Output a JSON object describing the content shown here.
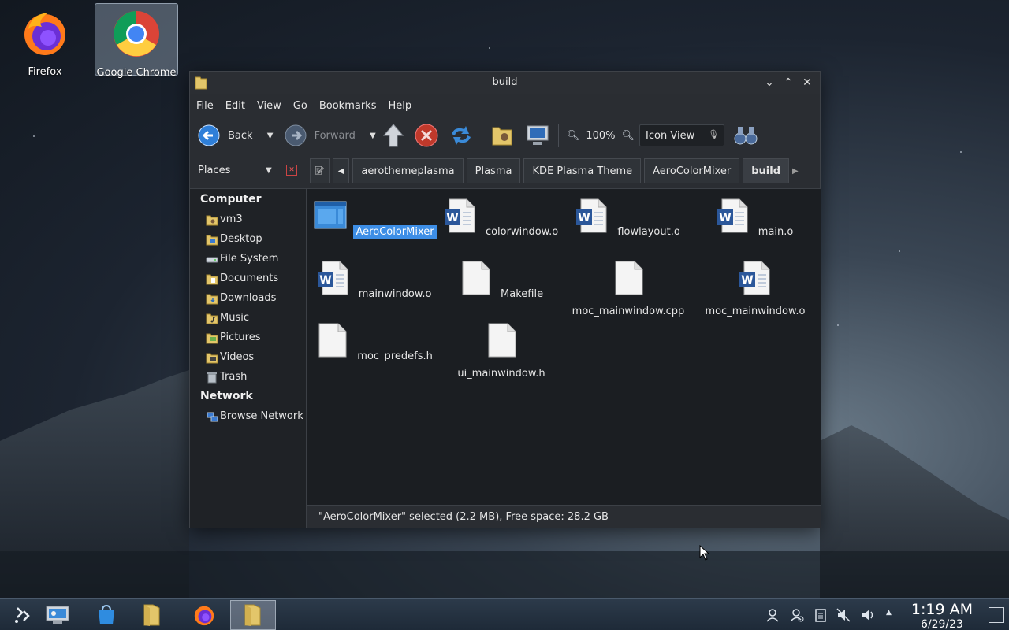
{
  "desktop": {
    "icons": [
      {
        "label": "Firefox"
      },
      {
        "label": "Google Chrome"
      }
    ]
  },
  "window": {
    "title": "build",
    "menu": [
      "File",
      "Edit",
      "View",
      "Go",
      "Bookmarks",
      "Help"
    ],
    "toolbar": {
      "back_label": "Back",
      "forward_label": "Forward",
      "zoom_level": "100%",
      "view_mode": "Icon View"
    },
    "places_label": "Places",
    "breadcrumbs": [
      "aerothemeplasma",
      "Plasma",
      "KDE Plasma Theme",
      "AeroColorMixer",
      "build"
    ],
    "sidebar": {
      "computer_label": "Computer",
      "computer_items": [
        "vm3",
        "Desktop",
        "File System",
        "Documents",
        "Downloads",
        "Music",
        "Pictures",
        "Videos",
        "Trash"
      ],
      "network_label": "Network",
      "network_items": [
        "Browse Network"
      ]
    },
    "files": [
      {
        "name": "AeroColorMixer",
        "type": "executable",
        "selected": true
      },
      {
        "name": "colorwindow.o",
        "type": "word"
      },
      {
        "name": "flowlayout.o",
        "type": "word"
      },
      {
        "name": "main.o",
        "type": "word"
      },
      {
        "name": "mainwindow.o",
        "type": "word"
      },
      {
        "name": "Makefile",
        "type": "blank"
      },
      {
        "name": "moc_mainwindow.cpp",
        "type": "blank"
      },
      {
        "name": "moc_mainwindow.o",
        "type": "word"
      },
      {
        "name": "moc_predefs.h",
        "type": "blank"
      },
      {
        "name": "ui_mainwindow.h",
        "type": "blank"
      }
    ],
    "status": "\"AeroColorMixer\" selected (2.2 MB), Free space: 28.2 GB"
  },
  "taskbar": {
    "time": "1:19 AM",
    "date": "6/29/23"
  },
  "colors": {
    "selection": "#3d8ee6",
    "window_bg": "#2a2d32",
    "content_bg": "#1b1e22"
  }
}
